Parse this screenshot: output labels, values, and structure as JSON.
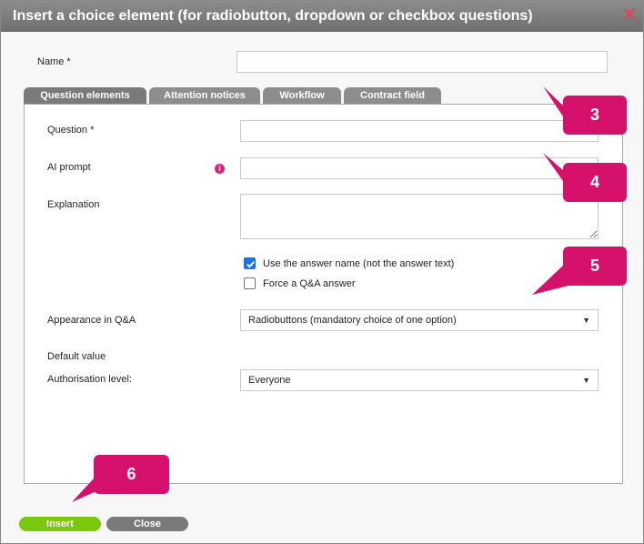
{
  "dialog": {
    "title": "Insert a choice element (for radiobutton, dropdown or checkbox questions)",
    "close_symbol": "✕",
    "close_icon": "close-x-icon",
    "accent_color": "#d6116b"
  },
  "name_field": {
    "label": "Name *",
    "value": ""
  },
  "tabs": [
    {
      "label": "Question elements",
      "active": true
    },
    {
      "label": "Attention notices",
      "active": false
    },
    {
      "label": "Workflow",
      "active": false
    },
    {
      "label": "Contract field",
      "active": false
    }
  ],
  "form": {
    "question": {
      "label": "Question *",
      "value": ""
    },
    "ai_prompt": {
      "label": "AI prompt",
      "value": "",
      "info_symbol": "i",
      "info_icon": "info-icon"
    },
    "explanation": {
      "label": "Explanation",
      "value": ""
    },
    "checkbox_answer_name": {
      "label": "Use the answer name (not the answer text)",
      "checked": true
    },
    "checkbox_force_qa": {
      "label": "Force a Q&A answer",
      "checked": false
    },
    "appearance": {
      "label": "Appearance in Q&A",
      "value": "Radiobuttons (mandatory choice of one option)",
      "arrow": "▼"
    },
    "default_value": {
      "label": "Default value"
    },
    "authorisation": {
      "label": "Authorisation level:",
      "value": "Everyone",
      "arrow": "▼"
    }
  },
  "buttons": {
    "insert_label": "Insert",
    "close_label": "Close"
  },
  "callouts": [
    "3",
    "4",
    "5",
    "6"
  ]
}
